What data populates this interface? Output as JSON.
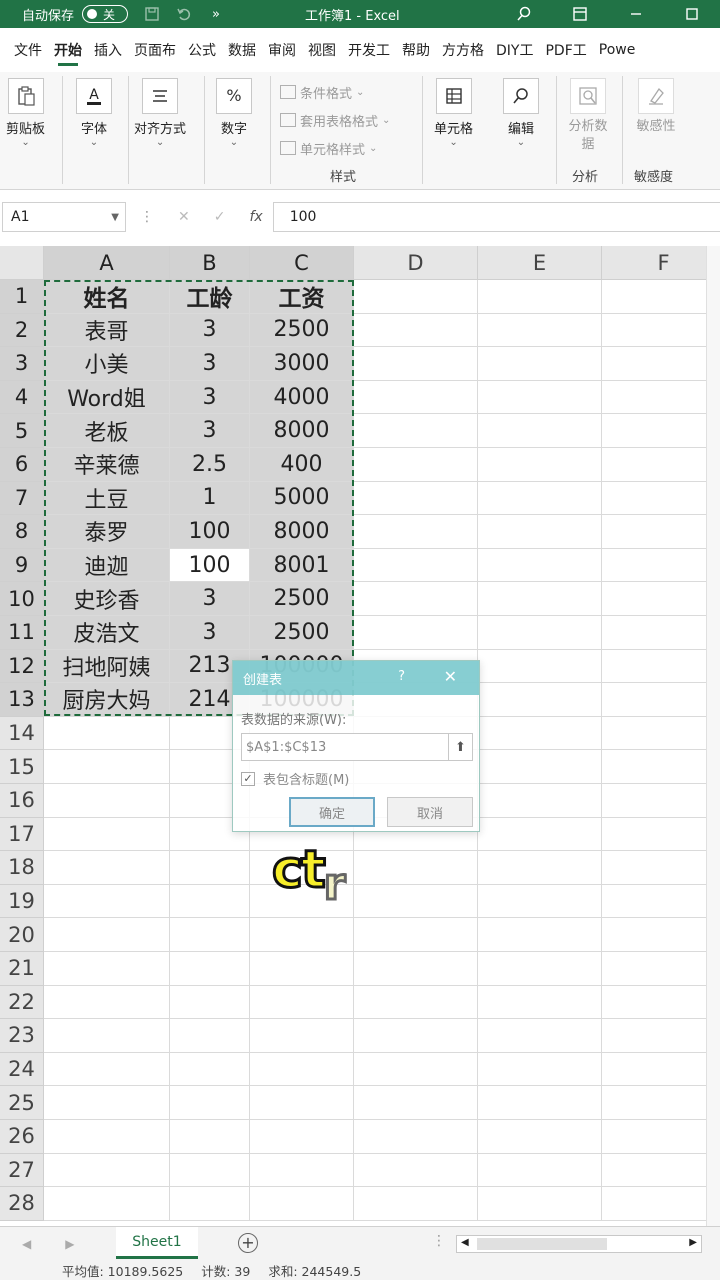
{
  "titlebar": {
    "autosave_label": "自动保存",
    "autosave_state": "关",
    "title": "工作簿1  -  Excel"
  },
  "tabs": [
    "文件",
    "开始",
    "插入",
    "页面布",
    "公式",
    "数据",
    "审阅",
    "视图",
    "开发工",
    "帮助",
    "方方格",
    "DIY工",
    "PDF工",
    "Powe"
  ],
  "active_tab": "开始",
  "ribbon": {
    "clipboard": "剪贴板",
    "font": "字体",
    "align": "对齐方式",
    "number": "数字",
    "cond_format": "条件格式",
    "table_format": "套用表格格式",
    "cell_style": "单元格样式",
    "styles_group": "样式",
    "cells": "单元格",
    "edit": "编辑",
    "analyze_data": "分析数据",
    "analyze_group": "分析",
    "sensitivity": "敏感性",
    "sensitivity_group": "敏感度"
  },
  "formula_bar": {
    "name_box": "A1",
    "value": "100"
  },
  "columns": [
    "A",
    "B",
    "C",
    "D",
    "E",
    "F"
  ],
  "rows": [
    [
      "姓名",
      "工龄",
      "工资"
    ],
    [
      "表哥",
      "3",
      "2500"
    ],
    [
      "小美",
      "3",
      "3000"
    ],
    [
      "Word姐",
      "3",
      "4000"
    ],
    [
      "老板",
      "3",
      "8000"
    ],
    [
      "辛莱德",
      "2.5",
      "400"
    ],
    [
      "土豆",
      "1",
      "5000"
    ],
    [
      "泰罗",
      "100",
      "8000"
    ],
    [
      "迪迦",
      "100",
      "8001"
    ],
    [
      "史珍香",
      "3",
      "2500"
    ],
    [
      "皮浩文",
      "3",
      "2500"
    ],
    [
      "扫地阿姨",
      "213",
      "100000"
    ],
    [
      "厨房大妈",
      "214",
      "100000"
    ]
  ],
  "row_numbers": [
    "1",
    "2",
    "3",
    "4",
    "5",
    "6",
    "7",
    "8",
    "9",
    "10",
    "11",
    "12",
    "13",
    "14",
    "15",
    "16",
    "17",
    "18",
    "19",
    "20",
    "21",
    "22",
    "23",
    "24",
    "25",
    "26",
    "27",
    "28"
  ],
  "dialog": {
    "title": "创建表",
    "help": "?",
    "source_label": "表数据的来源(W):",
    "range": "$A$1:$C$13",
    "has_headers": "表包含标题(M)",
    "ok": "确定",
    "cancel": "取消"
  },
  "caption": {
    "main": "ct",
    "tail": "r"
  },
  "sheet": {
    "name": "Sheet1"
  },
  "status": {
    "average": "平均值: 10189.5625",
    "count": "计数: 39",
    "sum": "求和: 244549.5"
  }
}
